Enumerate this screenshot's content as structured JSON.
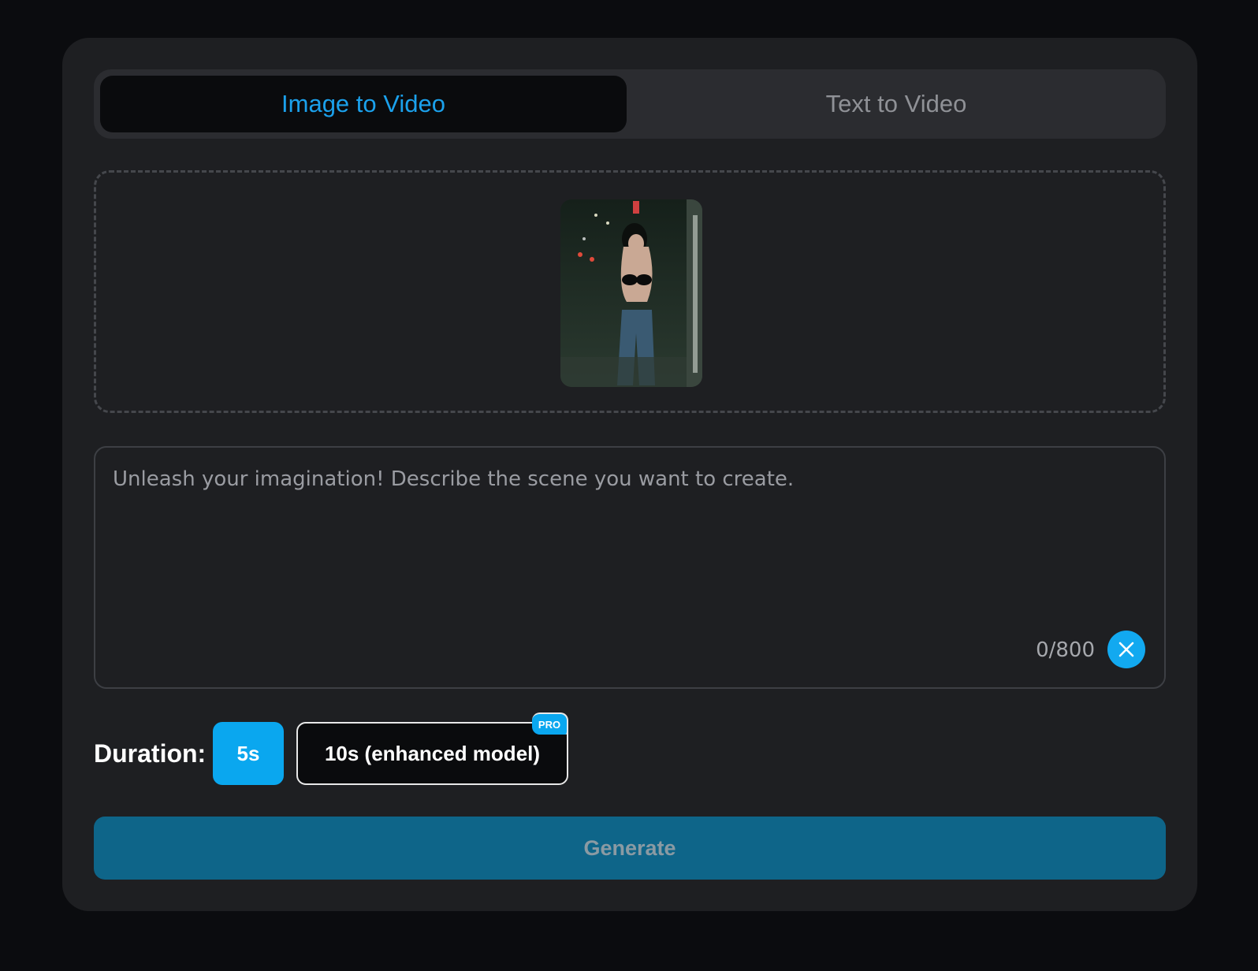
{
  "tabs": {
    "image_to_video": "Image to Video",
    "text_to_video": "Text to Video",
    "active": "image_to_video"
  },
  "upload": {
    "preview_description_icon": "photo-thumbnail"
  },
  "prompt": {
    "placeholder": "Unleash your imagination! Describe the scene you want to create.",
    "value": "",
    "counter": "0/800",
    "clear_icon": "close-icon"
  },
  "duration": {
    "label": "Duration:",
    "options": [
      {
        "label": "5s",
        "selected": true
      },
      {
        "label": "10s (enhanced model)",
        "selected": false,
        "badge": "PRO"
      }
    ]
  },
  "generate_label": "Generate",
  "colors": {
    "accent": "#0aa7ef",
    "active_tab_text": "#1ba1ec",
    "generate_bg": "#0e6589",
    "card_bg": "#1e1f22",
    "page_bg": "#0b0c0f"
  }
}
